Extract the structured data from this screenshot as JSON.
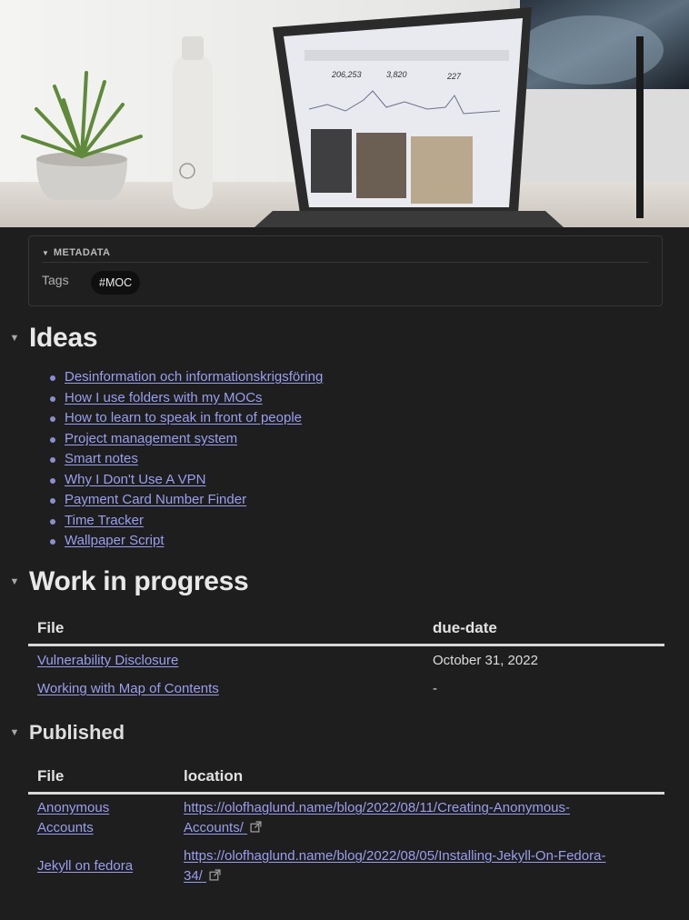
{
  "metadata": {
    "title": "METADATA",
    "tags_label": "Tags",
    "tags": [
      "#MOC"
    ]
  },
  "sections": {
    "ideas": {
      "title": "Ideas",
      "items": [
        "Desinformation och informationskrigsföring",
        "How I use folders with my MOCs",
        "How to learn to speak in front of people",
        "Project management system",
        "Smart notes",
        "Why I Don't Use A VPN",
        "Payment Card Number Finder",
        "Time Tracker",
        "Wallpaper Script"
      ]
    },
    "wip": {
      "title": "Work in progress",
      "columns": [
        "File",
        "due-date"
      ],
      "rows": [
        {
          "file": "Vulnerability Disclosure",
          "due": "October 31, 2022"
        },
        {
          "file": "Working with Map of Contents",
          "due": "-"
        }
      ]
    },
    "published": {
      "title": "Published",
      "columns": [
        "File",
        "location"
      ],
      "rows": [
        {
          "file_1": "Anonymous",
          "file_2": "Accounts",
          "loc_1": "https://olofhaglund.name/blog/2022/08/11/Creating-Anonymous-",
          "loc_2": "Accounts/"
        },
        {
          "file_1": "Jekyll on fedora",
          "file_2": "",
          "loc_1": "https://olofhaglund.name/blog/2022/08/05/Installing-Jekyll-On-Fedora-",
          "loc_2": "34/"
        }
      ]
    }
  },
  "banner": {
    "stats": [
      "206,253",
      "3,820",
      "227"
    ]
  },
  "colors": {
    "background": "#1e1e1e",
    "link": "#9a9ef0",
    "text": "#dcddde"
  }
}
